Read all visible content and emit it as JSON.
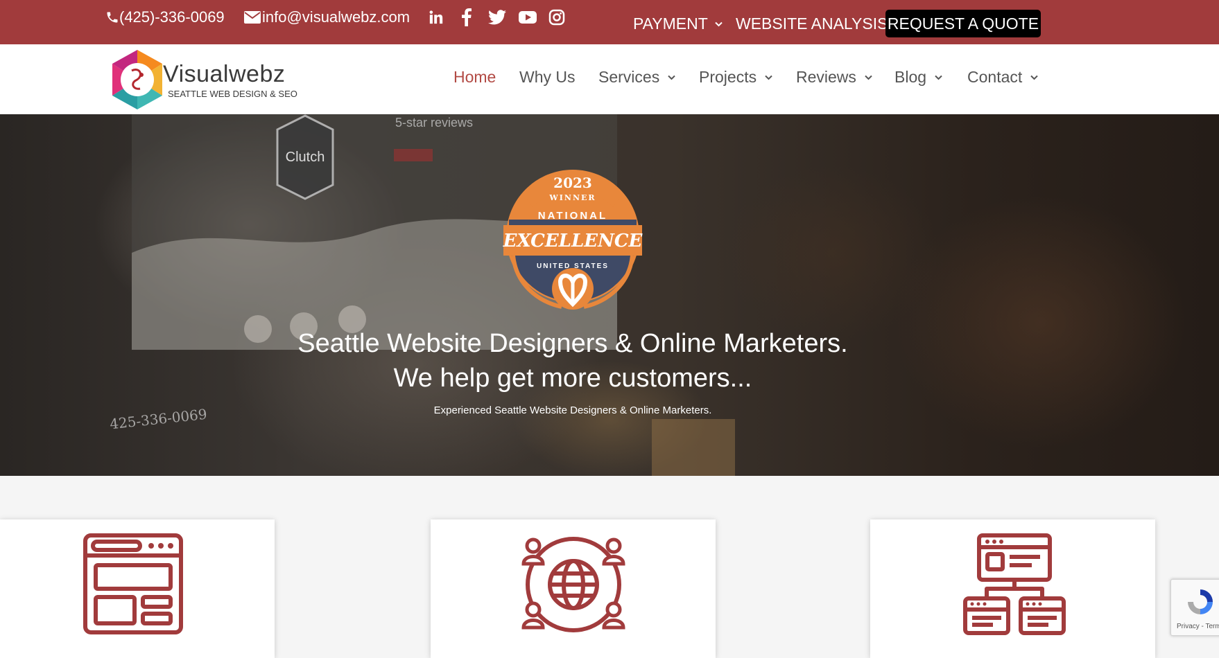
{
  "topbar": {
    "phone": "(425)-336-0069",
    "email": "info@visualwebz.com",
    "social_icons": [
      "linkedin-icon",
      "facebook-icon",
      "twitter-icon",
      "youtube-icon",
      "instagram-icon"
    ],
    "payment_label": "PAYMENT",
    "analysis_label": "WEBSITE ANALYSIS",
    "quote_label": "REQUEST A QUOTE",
    "bg_color": "#a13b3c"
  },
  "logo": {
    "name": "Visualwebz",
    "tagline": "SEATTLE WEB DESIGN & SEO"
  },
  "nav": {
    "items": [
      {
        "label": "Home"
      },
      {
        "label": "Why Us"
      },
      {
        "label": "Services"
      },
      {
        "label": "Projects"
      },
      {
        "label": "Reviews"
      },
      {
        "label": "Blog"
      },
      {
        "label": "Contact"
      }
    ],
    "active_color": "#b24a44"
  },
  "hero": {
    "badge": {
      "year": "2023",
      "winner": "WINNER",
      "national": "NATIONAL",
      "excellence": "EXCELLENCE",
      "country": "UNITED STATES"
    },
    "title_line1": "Seattle Website Designers & Online Marketers.",
    "title_line2": "We help get more customers...",
    "subtitle": "Experienced Seattle Website Designers & Online Marketers.",
    "background_text": {
      "reviews": "5-star reviews",
      "clutch": "Clutch",
      "phone_note": "425-336-0069"
    }
  },
  "cards": {
    "icons": [
      "website-layout-icon",
      "global-network-icon",
      "sitemap-icon"
    ],
    "accent_color": "#a13b3c"
  },
  "recaptcha": {
    "text": "Privacy - Terms"
  }
}
